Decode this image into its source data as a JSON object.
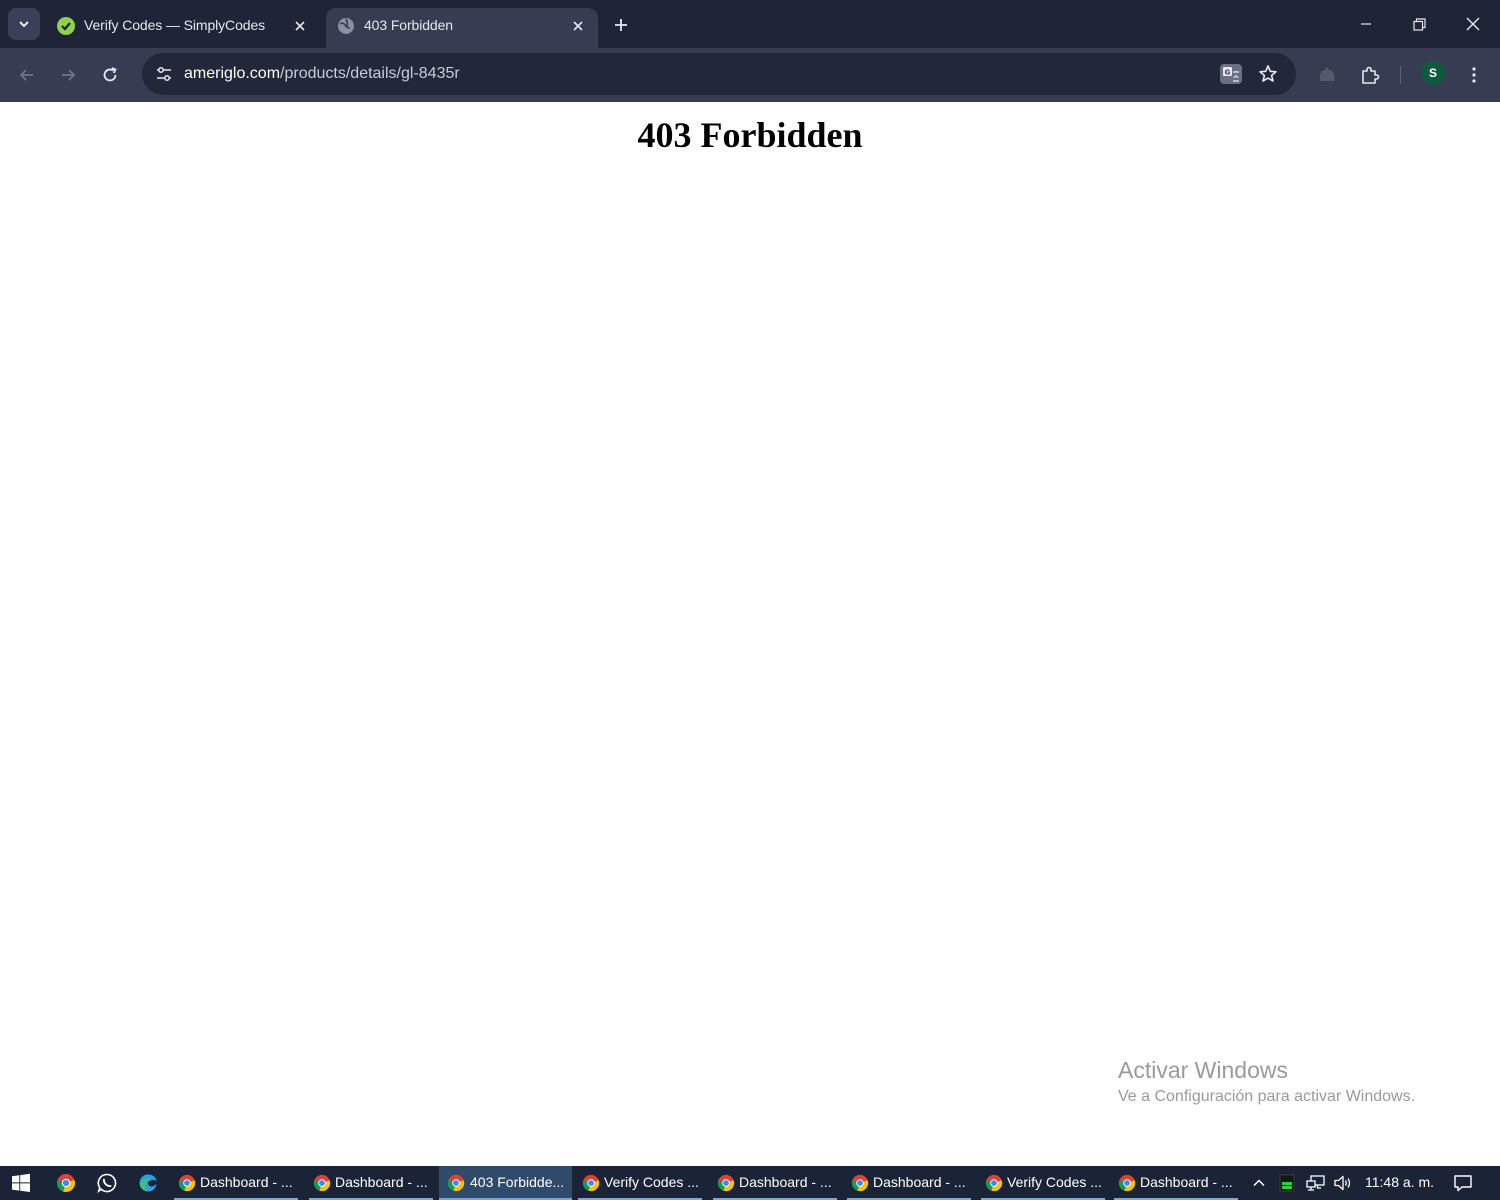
{
  "browser": {
    "tabs": [
      {
        "title": "Verify Codes — SimplyCodes",
        "active": false
      },
      {
        "title": "403 Forbidden",
        "active": true
      }
    ],
    "url_host": "ameriglo.com",
    "url_path": "/products/details/gl-8435r",
    "profile_initial": "S"
  },
  "page": {
    "heading": "403 Forbidden"
  },
  "watermark": {
    "title": "Activar Windows",
    "subtitle": "Ve a Configuración para activar Windows."
  },
  "taskbar": {
    "windows": [
      {
        "label": "Dashboard - ...",
        "active": false
      },
      {
        "label": "Dashboard - ...",
        "active": false
      },
      {
        "label": "403 Forbidde...",
        "active": true
      },
      {
        "label": "Verify Codes ...",
        "active": false
      },
      {
        "label": "Dashboard - ...",
        "active": false
      },
      {
        "label": "Dashboard - ...",
        "active": false
      },
      {
        "label": "Verify Codes ...",
        "active": false
      },
      {
        "label": "Dashboard - ...",
        "active": false
      }
    ],
    "clock": "11:48 a. m."
  },
  "colors": {
    "tabstrip": "#1f2437",
    "toolbar": "#363c52",
    "taskbar": "#1b2436",
    "avatar": "#0f5a3e",
    "simplycodes_green": "#8fd14f"
  }
}
